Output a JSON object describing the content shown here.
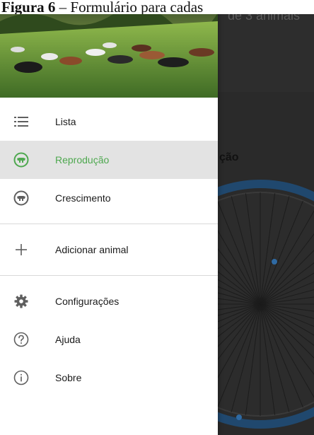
{
  "caption": {
    "label": "Figura 6",
    "text": " – Formulário para cadas",
    "overlap_text": "de 3 animais"
  },
  "drawer": {
    "menu": [
      {
        "id": "lista",
        "label": "Lista",
        "icon": "list-icon",
        "active": false
      },
      {
        "id": "reproducao",
        "label": "Reprodução",
        "icon": "cow-circle-icon",
        "active": true
      },
      {
        "id": "crescimento",
        "label": "Crescimento",
        "icon": "cow-circle-icon",
        "active": false
      }
    ],
    "actions": [
      {
        "id": "adicionar",
        "label": "Adicionar animal",
        "icon": "plus-icon"
      }
    ],
    "footer": [
      {
        "id": "configuracoes",
        "label": "Configurações",
        "icon": "gear-icon"
      },
      {
        "id": "ajuda",
        "label": "Ajuda",
        "icon": "help-icon"
      },
      {
        "id": "sobre",
        "label": "Sobre",
        "icon": "info-icon"
      }
    ]
  },
  "background": {
    "title_fragment": "ção"
  },
  "colors": {
    "accent": "#4ea84f",
    "icon": "#5f5f5f",
    "active_bg": "#e3e3e3",
    "backdrop": "#2a2a2a"
  }
}
